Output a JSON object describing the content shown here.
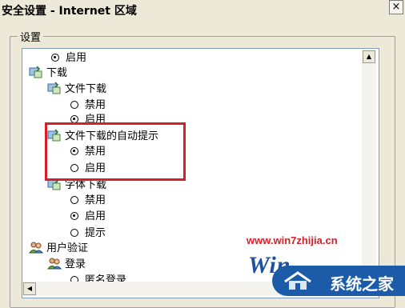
{
  "window": {
    "title": "安全设置 - Internet 区域",
    "close_glyph": "×"
  },
  "group": {
    "label": "设置"
  },
  "tree": {
    "rows": [
      {
        "text": "启用"
      },
      {
        "text": "下载"
      },
      {
        "text": "文件下载"
      },
      {
        "text": "禁用"
      },
      {
        "text": "启用"
      },
      {
        "text": "文件下载的自动提示"
      },
      {
        "text": "禁用"
      },
      {
        "text": "启用"
      },
      {
        "text": "字体下载"
      },
      {
        "text": "禁用"
      },
      {
        "text": "启用"
      },
      {
        "text": "提示"
      },
      {
        "text": "用户验证"
      },
      {
        "text": "登录"
      },
      {
        "text": "匿名登录"
      }
    ]
  },
  "scroll": {
    "up": "▲",
    "left": "◀"
  },
  "watermark": {
    "url": "www.win7zhijia.cn",
    "logo": "Win",
    "brand": "系统之家"
  },
  "colors": {
    "highlight": "#d42026",
    "list_border": "#7f9db9",
    "dialog_bg": "#ece9d8"
  }
}
